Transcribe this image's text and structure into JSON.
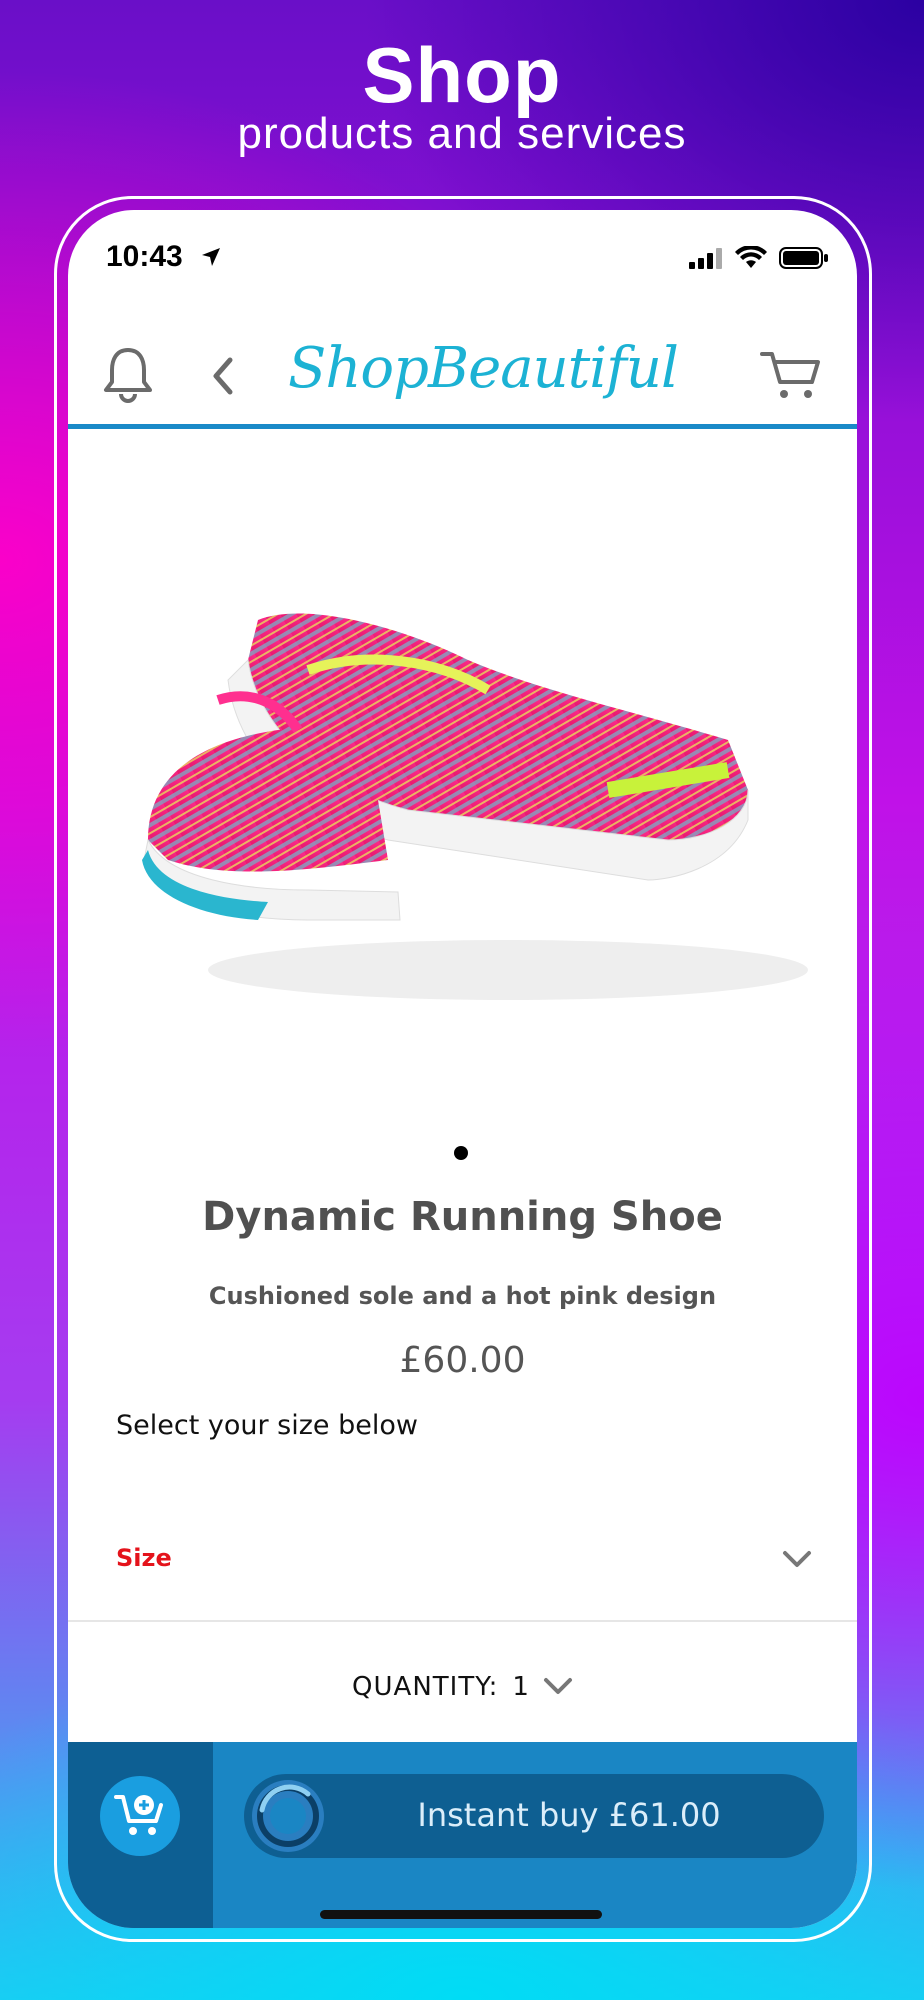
{
  "promo": {
    "title": "Shop",
    "subtitle": "products and services"
  },
  "status_bar": {
    "time": "10:43",
    "icons": [
      "location-arrow-icon",
      "cellular-signal-icon",
      "wifi-icon",
      "battery-icon"
    ]
  },
  "nav": {
    "brand": "ShopBeautiful",
    "brand_color": "#1cb2d4",
    "icons": [
      "bell-icon",
      "back-chevron-icon",
      "cart-icon"
    ]
  },
  "product": {
    "name": "Dynamic Running Shoe",
    "description": "Cushioned sole and a hot pink design",
    "price": "£60.00",
    "image": "pink-running-shoes-image",
    "carousel_dots": 1
  },
  "size": {
    "hint": "Select your size below",
    "label": "Size",
    "label_color": "#e4131b"
  },
  "quantity": {
    "label": "QUANTITY:",
    "value": "1"
  },
  "bottom_bar": {
    "instant_buy_label": "Instant buy £61.00",
    "accent_color": "#1a86c4"
  }
}
